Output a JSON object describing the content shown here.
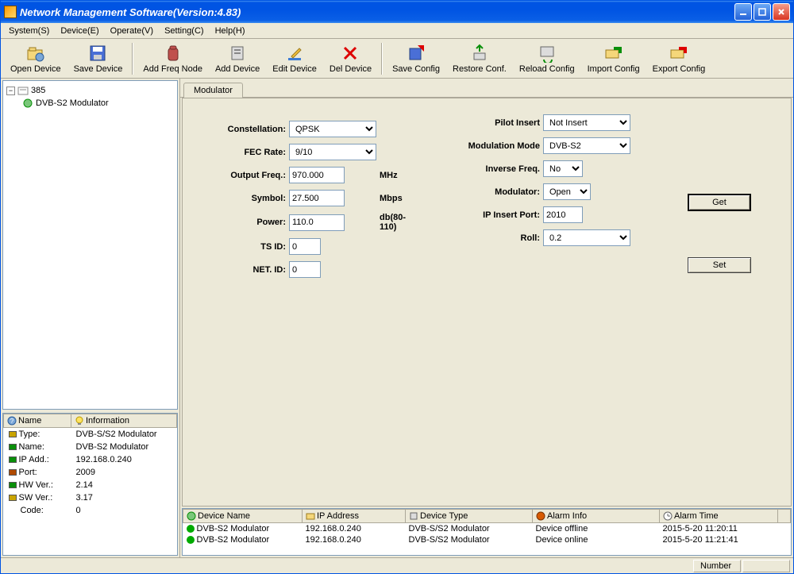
{
  "title": "Network Management Software(Version:4.83)",
  "menu": {
    "system": "System(S)",
    "device": "Device(E)",
    "operate": "Operate(V)",
    "setting": "Setting(C)",
    "help": "Help(H)"
  },
  "toolbar": {
    "open": "Open Device",
    "save": "Save Device",
    "addfreq": "Add Freq Node",
    "adddev": "Add Device",
    "editdev": "Edit Device",
    "deldev": "Del Device",
    "savecfg": "Save Config",
    "restorecfg": "Restore Conf.",
    "reloadcfg": "Reload Config",
    "importcfg": "Import Config",
    "exportcfg": "Export Config"
  },
  "tree": {
    "root": "385",
    "child": "DVB-S2 Modulator"
  },
  "info": {
    "headers": {
      "name": "Name",
      "info": "Information"
    },
    "rows": [
      {
        "k": "Type:",
        "v": "DVB-S/S2 Modulator",
        "color": "#c9a400"
      },
      {
        "k": "Name:",
        "v": "DVB-S2 Modulator",
        "color": "#0a8f0a"
      },
      {
        "k": "IP Add.:",
        "v": "192.168.0.240",
        "color": "#0a8f0a"
      },
      {
        "k": "Port:",
        "v": "2009",
        "color": "#b04a00"
      },
      {
        "k": "HW Ver.:",
        "v": "2.14",
        "color": "#0a8f0a"
      },
      {
        "k": "SW Ver.:",
        "v": "3.17",
        "color": "#c9a400"
      },
      {
        "k": "Code:",
        "v": "0",
        "color": ""
      }
    ]
  },
  "tab": "Modulator",
  "form": {
    "constellation": {
      "label": "Constellation:",
      "value": "QPSK"
    },
    "fec": {
      "label": "FEC Rate:",
      "value": "9/10"
    },
    "outfreq": {
      "label": "Output Freq.:",
      "value": "970.000",
      "unit": "MHz"
    },
    "symbol": {
      "label": "Symbol:",
      "value": "27.500",
      "unit": "Mbps"
    },
    "power": {
      "label": "Power:",
      "value": "110.0",
      "unit": "db(80-110)"
    },
    "tsid": {
      "label": "TS ID:",
      "value": "0"
    },
    "netid": {
      "label": "NET. ID:",
      "value": "0"
    },
    "pilot": {
      "label": "Pilot Insert",
      "value": "Not Insert"
    },
    "modmode": {
      "label": "Modulation Mode",
      "value": "DVB-S2"
    },
    "invfreq": {
      "label": "Inverse Freq.",
      "value": "No"
    },
    "modulator": {
      "label": "Modulator:",
      "value": "Open"
    },
    "ipport": {
      "label": "IP Insert Port:",
      "value": "2010"
    },
    "roll": {
      "label": "Roll:",
      "value": "0.2"
    }
  },
  "buttons": {
    "get": "Get",
    "set": "Set"
  },
  "devlist": {
    "headers": {
      "name": "Device Name",
      "ip": "IP Address",
      "type": "Device Type",
      "alarm": "Alarm Info",
      "time": "Alarm Time"
    },
    "rows": [
      {
        "name": "DVB-S2 Modulator",
        "ip": "192.168.0.240",
        "type": "DVB-S/S2 Modulator",
        "alarm": "Device offline",
        "time": "2015-5-20 11:20:11"
      },
      {
        "name": "DVB-S2 Modulator",
        "ip": "192.168.0.240",
        "type": "DVB-S/S2 Modulator",
        "alarm": "Device online",
        "time": "2015-5-20 11:21:41"
      }
    ]
  },
  "status": {
    "number": "Number"
  }
}
